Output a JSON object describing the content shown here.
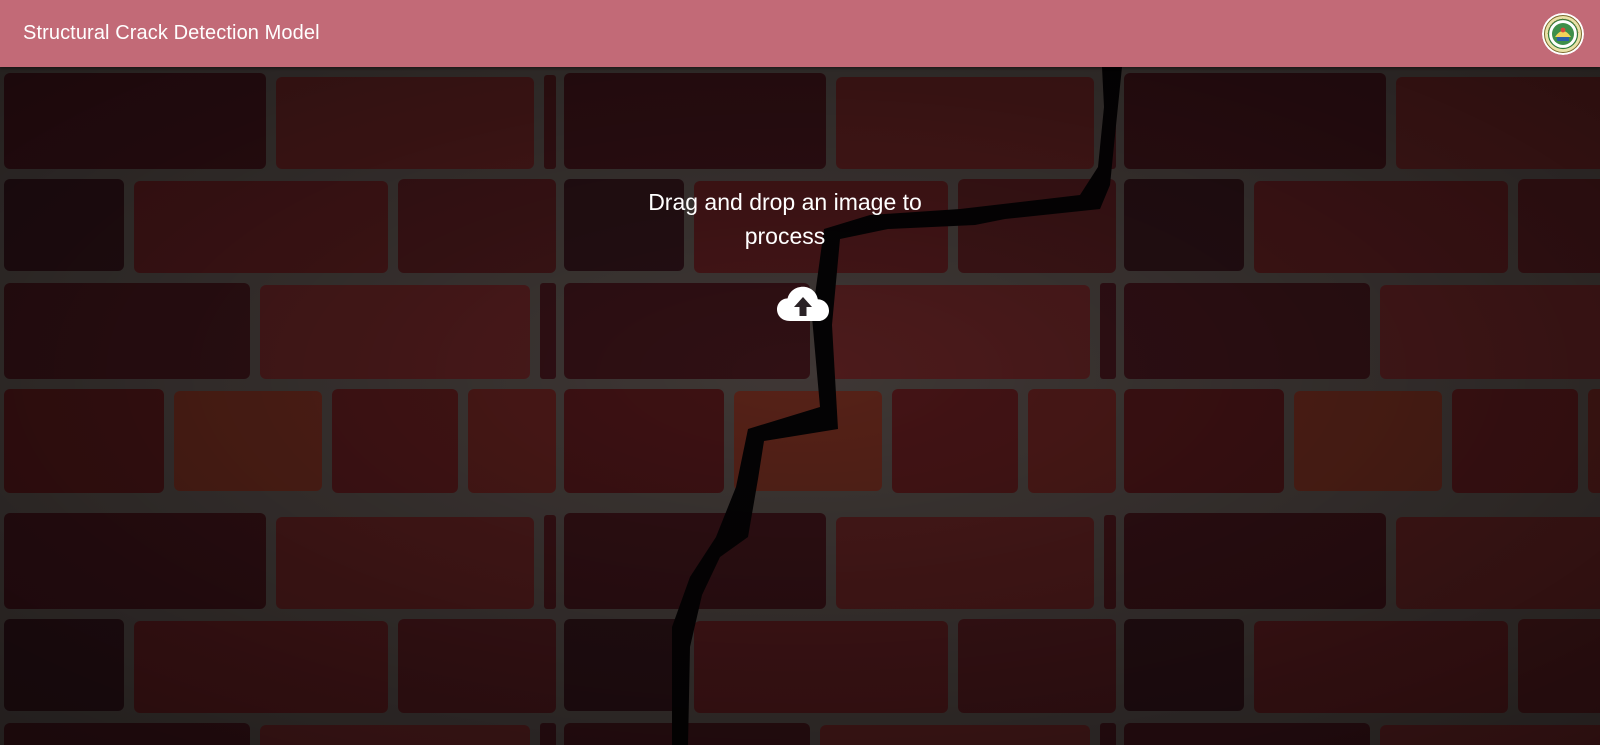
{
  "header": {
    "title": "Structural Crack Detection Model",
    "logo_icon": "university-seal-icon",
    "background_color": "#c26a77"
  },
  "dropzone": {
    "prompt": "Drag and drop an image to process",
    "upload_icon": "cloud-upload-icon"
  },
  "background": {
    "image": "dark-red-brick-wall-with-crack"
  }
}
